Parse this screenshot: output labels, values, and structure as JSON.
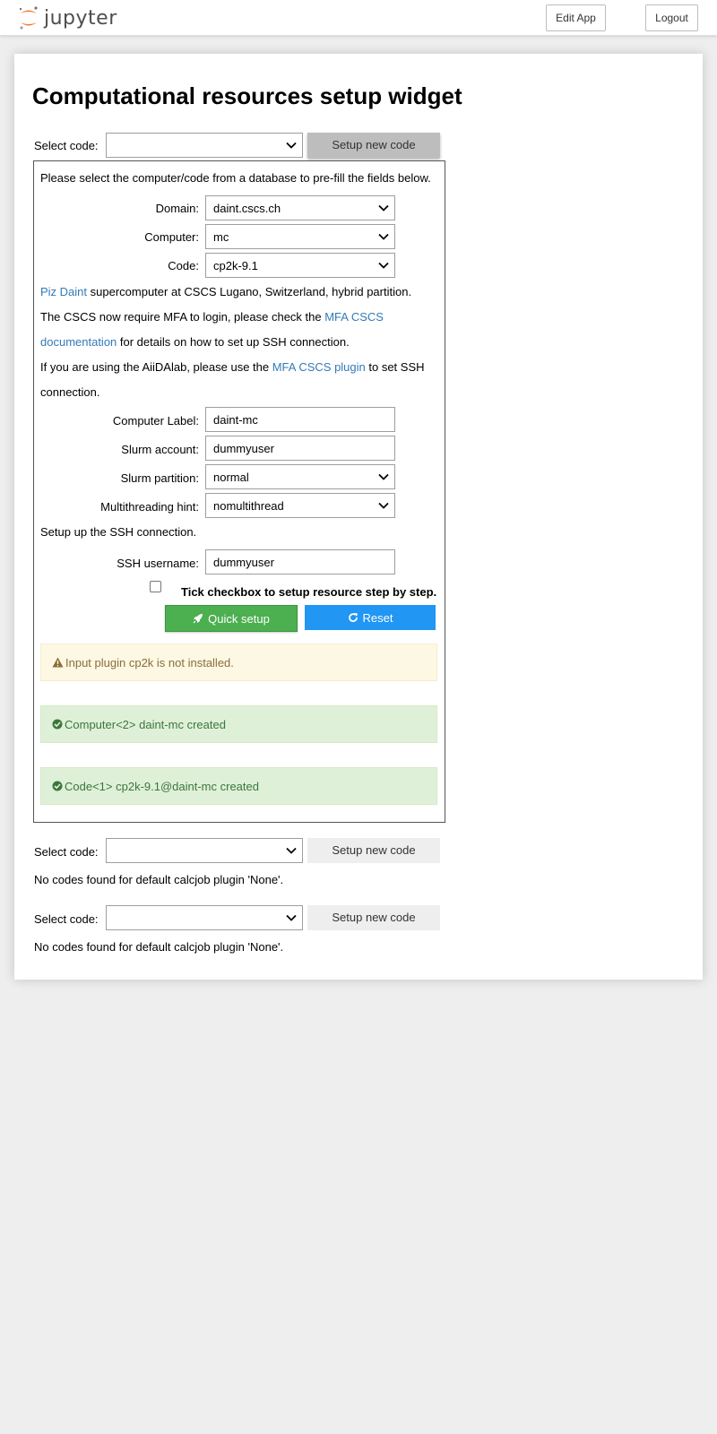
{
  "header": {
    "logo_text": "jupyter",
    "edit_app": "Edit App",
    "logout": "Logout"
  },
  "page": {
    "title": "Computational resources setup widget"
  },
  "widget1": {
    "select_code_label": "Select code:",
    "select_code_value": "",
    "setup_new_code": "Setup new code",
    "prefill_text": "Please select the computer/code from a database to pre-fill the fields below.",
    "domain_label": "Domain:",
    "domain_value": "daint.cscs.ch",
    "computer_label": "Computer:",
    "computer_value": "mc",
    "code_label": "Code:",
    "code_value": "cp2k-9.1",
    "desc_link": "Piz Daint",
    "desc_rest": " supercomputer at CSCS Lugano, Switzerland, hybrid partition.",
    "mfa_text_1": "The CSCS now require MFA to login, please check the ",
    "mfa_link_1": "MFA CSCS documentation",
    "mfa_text_2": " for details on how to set up SSH connection.",
    "aiida_text_1": "If you are using the AiiDAlab, please use the ",
    "aiida_link": "MFA CSCS plugin",
    "aiida_text_2": " to set SSH connection.",
    "computer_label_label": "Computer Label:",
    "computer_label_value": "daint-mc",
    "slurm_account_label": "Slurm account:",
    "slurm_account_value": "dummyuser",
    "slurm_partition_label": "Slurm partition:",
    "slurm_partition_value": "normal",
    "multithreading_label": "Multithreading hint:",
    "multithreading_value": "nomultithread",
    "ssh_setup_text": "Setup up the SSH connection.",
    "ssh_username_label": "SSH username:",
    "ssh_username_value": "dummyuser",
    "step_checkbox_label": "Tick checkbox to setup resource step by step.",
    "quick_setup": "Quick setup",
    "reset": "Reset",
    "alert_warning": "Input plugin cp2k is not installed.",
    "alert_computer": "Computer<2> daint-mc created",
    "alert_code": "Code<1> cp2k-9.1@daint-mc created"
  },
  "widget2": {
    "select_code_label": "Select code:",
    "setup_new_code": "Setup new code",
    "message": "No codes found for default calcjob plugin 'None'."
  },
  "widget3": {
    "select_code_label": "Select code:",
    "setup_new_code": "Setup new code",
    "message": "No codes found for default calcjob plugin 'None'."
  },
  "colors": {
    "success": "#4caf50",
    "primary": "#2196f3",
    "link": "#337ab7"
  }
}
